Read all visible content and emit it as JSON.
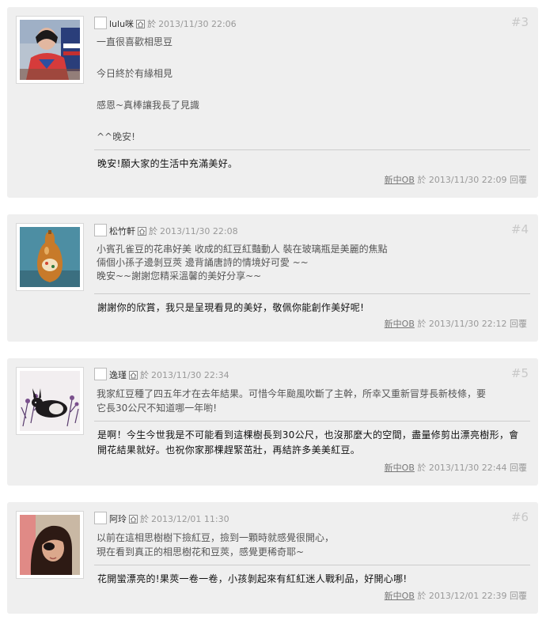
{
  "comments": [
    {
      "number": "#3",
      "author": "lulu咪",
      "on": "於",
      "datetime": "2013/11/30 22:06",
      "lines": [
        "一直很喜歡相思豆",
        "今日終於有緣相見",
        "感恩~真棒讓我長了見識",
        "^^晚安!"
      ],
      "reply": "晚安!願大家的生活中充滿美好。",
      "replier": "新中OB",
      "reply_on": "於",
      "reply_datetime": "2013/11/30 22:09",
      "reply_link": "回覆"
    },
    {
      "number": "#4",
      "author": "松竹軒",
      "on": "於",
      "datetime": "2013/11/30 22:08",
      "lines": [
        "小賓孔雀豆的花串好美 收成的紅豆紅豔動人 裝在玻璃瓶是美麗的焦點",
        "倆個小孫子邊剝豆莢 邊背誦唐詩的情境好可愛 ~~",
        "晚安~~謝謝您精采溫馨的美好分享~~"
      ],
      "reply": "謝謝你的欣賞，我只是呈現看見的美好，敬佩你能創作美好呢!",
      "replier": "新中OB",
      "reply_on": "於",
      "reply_datetime": "2013/11/30 22:12",
      "reply_link": "回覆"
    },
    {
      "number": "#5",
      "author": "逸瑾",
      "on": "於",
      "datetime": "2013/11/30 22:34",
      "lines": [
        "我家紅豆種了四五年才在去年結果。可惜今年颱風吹斷了主幹，所幸又重新冒芽長新枝條，要",
        "它長30公尺不知道哪一年喲!"
      ],
      "reply": "是啊！今生今世我是不可能看到這棵樹長到30公尺，也沒那麼大的空間，盡量修剪出漂亮樹形，會開花結果就好。也祝你家那棵趕緊茁壯，再結許多美美紅豆。",
      "replier": "新中OB",
      "reply_on": "於",
      "reply_datetime": "2013/11/30 22:44",
      "reply_link": "回覆"
    },
    {
      "number": "#6",
      "author": "阿玲",
      "on": "於",
      "datetime": "2013/12/01 11:30",
      "lines": [
        "以前在這相思樹樹下撿紅豆，撿到一顆時就感覺很開心，",
        "現在看到真正的相思樹花和豆莢，感覺更稀奇耶~"
      ],
      "reply": "花開蠻漂亮的!果莢一卷一卷，小孩剝起來有紅紅迷人戰利品，好開心哪!",
      "replier": "新中OB",
      "reply_on": "於",
      "reply_datetime": "2013/12/01 22:39",
      "reply_link": "回覆"
    }
  ]
}
